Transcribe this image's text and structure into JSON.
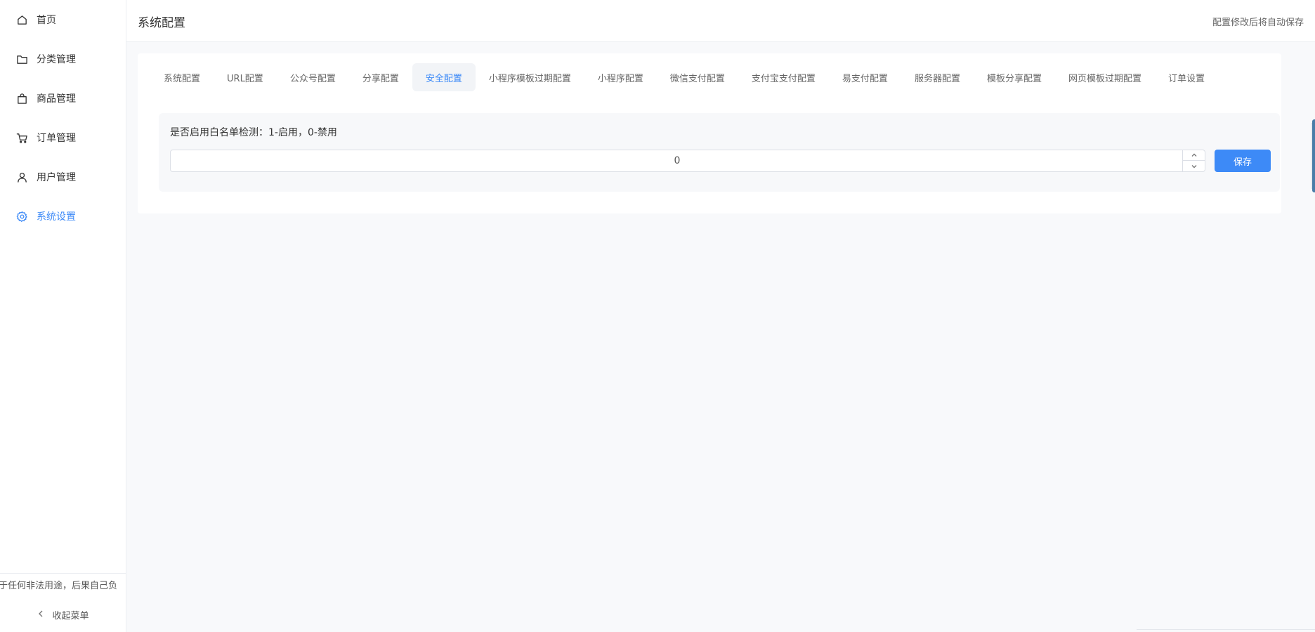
{
  "sidebar": {
    "items": [
      {
        "label": "首页",
        "icon": "home-icon",
        "active": false
      },
      {
        "label": "分类管理",
        "icon": "folder-icon",
        "active": false
      },
      {
        "label": "商品管理",
        "icon": "shopping-bag-icon",
        "active": false
      },
      {
        "label": "订单管理",
        "icon": "cart-icon",
        "active": false
      },
      {
        "label": "用户管理",
        "icon": "user-icon",
        "active": false
      },
      {
        "label": "系统设置",
        "icon": "gear-icon",
        "active": true
      }
    ],
    "disclaimer": "于任何非法用途，后果自己负",
    "collapse_label": "收起菜单"
  },
  "header": {
    "title": "系统配置",
    "hint": "配置修改后将自动保存"
  },
  "tabs": [
    {
      "label": "系统配置",
      "active": false
    },
    {
      "label": "URL配置",
      "active": false
    },
    {
      "label": "公众号配置",
      "active": false
    },
    {
      "label": "分享配置",
      "active": false
    },
    {
      "label": "安全配置",
      "active": true
    },
    {
      "label": "小程序模板过期配置",
      "active": false
    },
    {
      "label": "小程序配置",
      "active": false
    },
    {
      "label": "微信支付配置",
      "active": false
    },
    {
      "label": "支付宝支付配置",
      "active": false
    },
    {
      "label": "易支付配置",
      "active": false
    },
    {
      "label": "服务器配置",
      "active": false
    },
    {
      "label": "模板分享配置",
      "active": false
    },
    {
      "label": "网页模板过期配置",
      "active": false
    },
    {
      "label": "订单设置",
      "active": false
    }
  ],
  "form": {
    "label": "是否启用白名单检测：1-启用，0-禁用",
    "value": "0",
    "save_label": "保存"
  },
  "colors": {
    "accent": "#3d8af7",
    "active_tab_bg": "#f2f4f7",
    "page_bg": "#f8f9fb"
  }
}
